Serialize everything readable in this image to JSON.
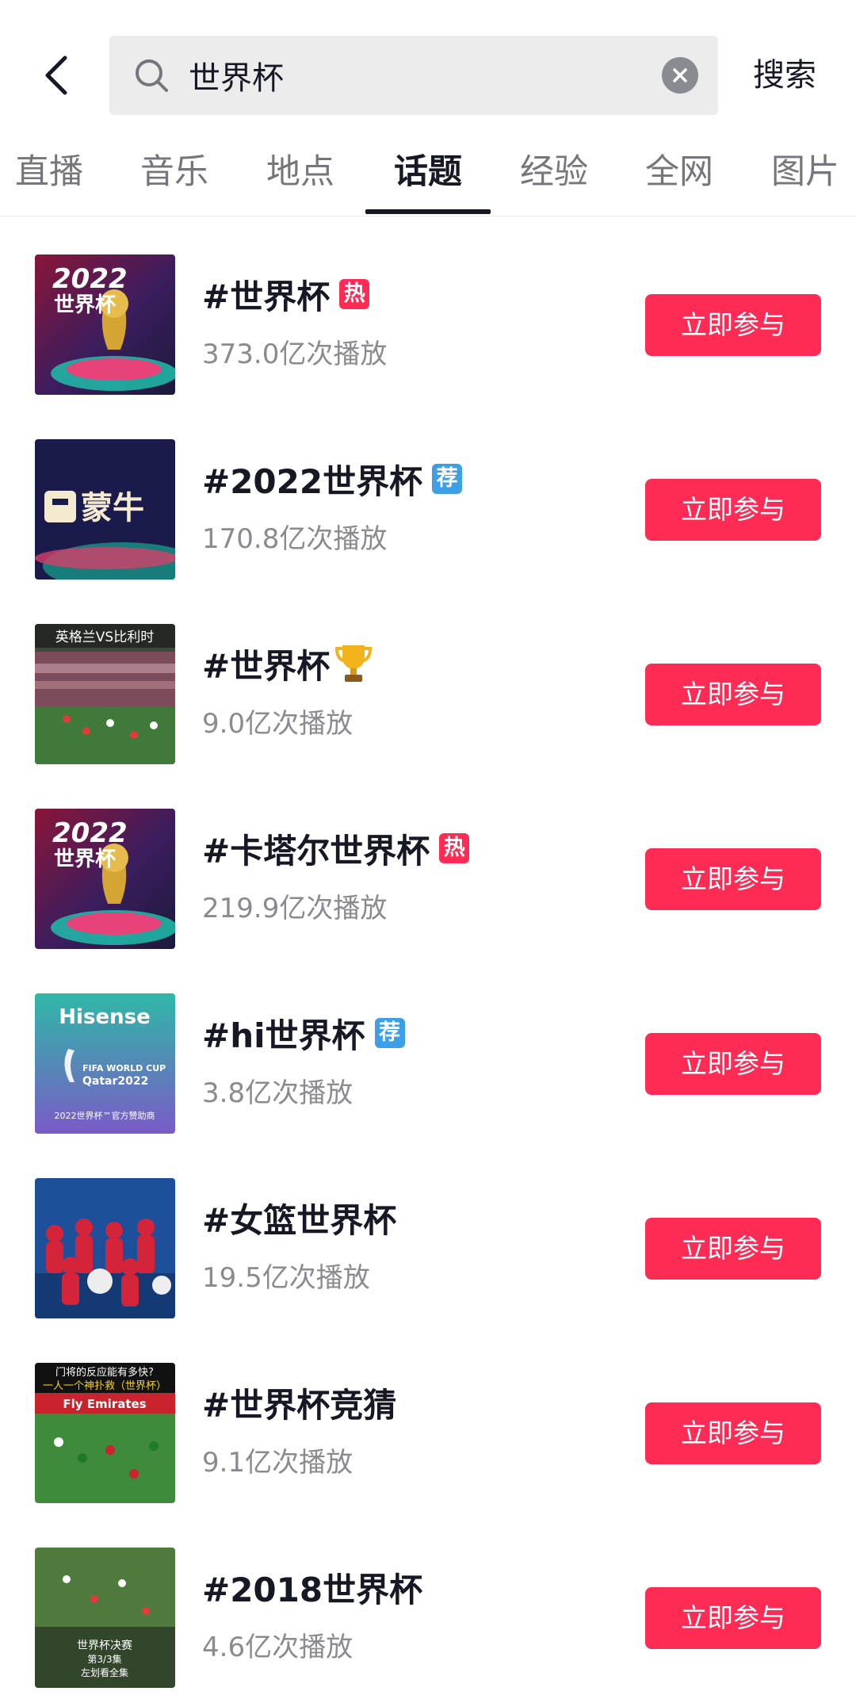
{
  "search": {
    "query": "世界杯",
    "action_label": "搜索"
  },
  "tabs": [
    {
      "label": "直播",
      "active": false
    },
    {
      "label": "音乐",
      "active": false
    },
    {
      "label": "地点",
      "active": false
    },
    {
      "label": "话题",
      "active": true
    },
    {
      "label": "经验",
      "active": false
    },
    {
      "label": "全网",
      "active": false
    },
    {
      "label": "图片",
      "active": false
    }
  ],
  "topics": [
    {
      "title": "#世界杯",
      "badge": "热",
      "badge_type": "hot",
      "views": "373.0亿次播放",
      "button": "立即参与",
      "thumb_text": [
        "2022",
        "世界杯"
      ]
    },
    {
      "title": "#2022世界杯",
      "badge": "荐",
      "badge_type": "rec",
      "views": "170.8亿次播放",
      "button": "立即参与",
      "thumb_text": [
        "蒙牛"
      ]
    },
    {
      "title": "#世界杯",
      "badge": "trophy-emoji",
      "badge_type": "trophy",
      "views": "9.0亿次播放",
      "button": "立即参与",
      "thumb_text": [
        "英格兰VS比利时"
      ]
    },
    {
      "title": "#卡塔尔世界杯",
      "badge": "热",
      "badge_type": "hot",
      "views": "219.9亿次播放",
      "button": "立即参与",
      "thumb_text": [
        "2022",
        "世界杯"
      ]
    },
    {
      "title": "#hi世界杯",
      "badge": "荐",
      "badge_type": "rec",
      "views": "3.8亿次播放",
      "button": "立即参与",
      "thumb_text": [
        "Hisense",
        "FIFA WORLD CUP",
        "Qatar2022",
        "2022世界杯™官方赞助商"
      ]
    },
    {
      "title": "#女篮世界杯",
      "badge": "",
      "badge_type": "none",
      "views": "19.5亿次播放",
      "button": "立即参与",
      "thumb_text": []
    },
    {
      "title": "#世界杯竞猜",
      "badge": "",
      "badge_type": "none",
      "views": "9.1亿次播放",
      "button": "立即参与",
      "thumb_text": [
        "门将的反应能有多快?",
        "一人一个神扑救（世界杯）",
        "Fly Emirates"
      ]
    },
    {
      "title": "#2018世界杯",
      "badge": "",
      "badge_type": "none",
      "views": "4.6亿次播放",
      "button": "立即参与",
      "thumb_text": [
        "世界杯决赛",
        "第3/3集",
        "左划看全集"
      ]
    }
  ],
  "colors": {
    "accent": "#fe2c55",
    "recommend": "#3d9fe6",
    "text_primary": "#161823",
    "text_secondary": "#8a8b91",
    "search_bg": "#ececec"
  }
}
